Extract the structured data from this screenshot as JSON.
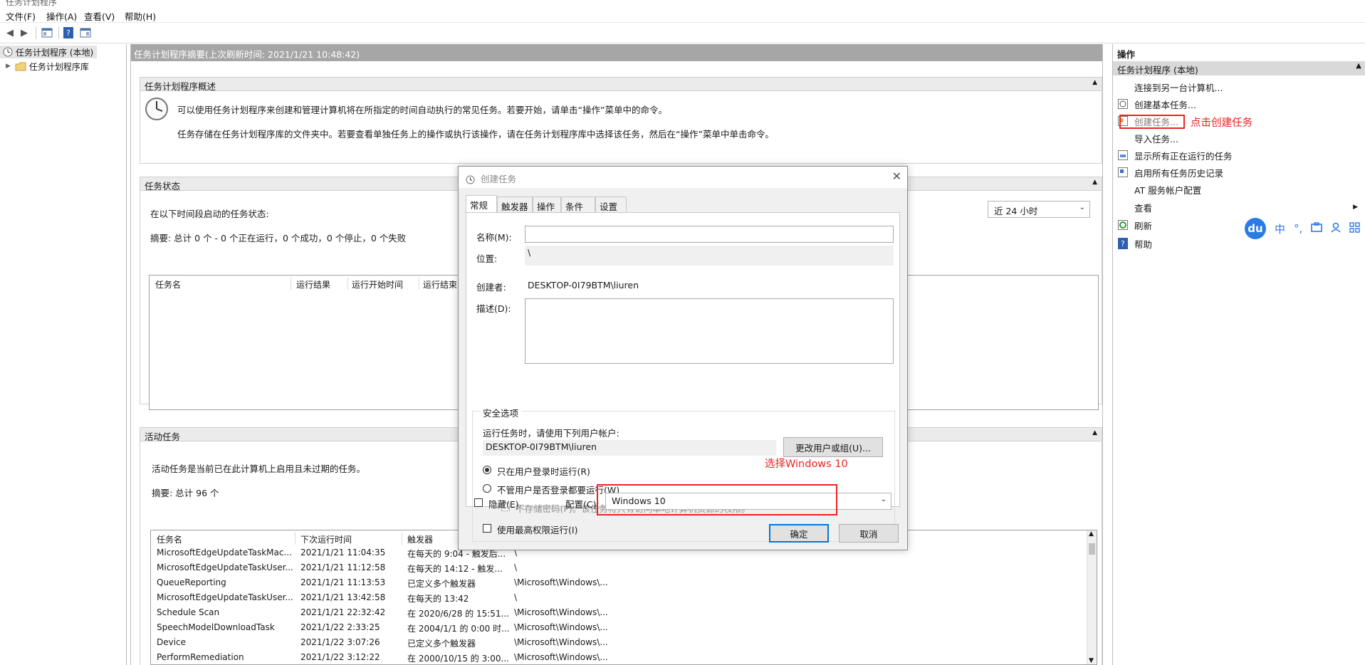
{
  "window": {
    "title": "任务计划程序"
  },
  "menu": [
    "文件(F)",
    "操作(A)",
    "查看(V)",
    "帮助(H)"
  ],
  "tree": {
    "root": "任务计划程序 (本地)",
    "library": "任务计划程序库"
  },
  "center": {
    "header": "任务计划程序摘要(上次刷新时间: 2021/1/21 10:48:42)",
    "overview": {
      "title": "任务计划程序概述",
      "line1": "可以使用任务计划程序来创建和管理计算机将在所指定的时间自动执行的常见任务。若要开始，请单击“操作”菜单中的命令。",
      "line2": "任务存储在任务计划程序库的文件夹中。若要查看单独任务上的操作或执行该操作，请在任务计划程序库中选择该任务，然后在“操作”菜单中单击命令。"
    },
    "status": {
      "title": "任务状态",
      "period_label": "在以下时间段启动的任务状态:",
      "summary": "摘要: 总计 0 个 - 0 个正在运行，0 个成功，0 个停止，0 个失败",
      "period_select": "近 24 小时",
      "columns": [
        "任务名",
        "运行结果",
        "运行开始时间",
        "运行结束时"
      ]
    },
    "active": {
      "title": "活动任务",
      "description": "活动任务是当前已在此计算机上启用且未过期的任务。",
      "summary": "摘要: 总计 96 个",
      "columns": [
        "任务名",
        "下次运行时间",
        "触发器"
      ],
      "rows": [
        [
          "MicrosoftEdgeUpdateTaskMac...",
          "2021/1/21 11:04:35",
          "在每天的 9:04 - 触发后...",
          "\\"
        ],
        [
          "MicrosoftEdgeUpdateTaskUser...",
          "2021/1/21 11:12:58",
          "在每天的 14:12 - 触发...",
          "\\"
        ],
        [
          "QueueReporting",
          "2021/1/21 11:13:53",
          "已定义多个触发器",
          "\\Microsoft\\Windows\\..."
        ],
        [
          "MicrosoftEdgeUpdateTaskUser...",
          "2021/1/21 13:42:58",
          "在每天的 13:42",
          "\\"
        ],
        [
          "Schedule Scan",
          "2021/1/21 22:32:42",
          "在 2020/6/28 的 15:51...",
          "\\Microsoft\\Windows\\..."
        ],
        [
          "SpeechModelDownloadTask",
          "2021/1/22 2:33:25",
          "在 2004/1/1 的 0:00 时...",
          "\\Microsoft\\Windows\\..."
        ],
        [
          "Device",
          "2021/1/22 3:07:26",
          "已定义多个触发器",
          "\\Microsoft\\Windows\\..."
        ],
        [
          "PerformRemediation",
          "2021/1/22 3:12:22",
          "在 2000/10/15 的 3:00...",
          "\\Microsoft\\Windows\\..."
        ]
      ]
    }
  },
  "actions": {
    "title": "操作",
    "section": "任务计划程序 (本地)",
    "items": [
      "连接到另一台计算机...",
      "创建基本任务...",
      "创建任务...",
      "导入任务...",
      "显示所有正在运行的任务",
      "启用所有任务历史记录",
      "AT 服务帐户配置",
      "查看",
      "刷新",
      "帮助"
    ]
  },
  "dialog": {
    "title": "创建任务",
    "tabs": [
      "常规",
      "触发器",
      "操作",
      "条件",
      "设置"
    ],
    "name_label": "名称(M):",
    "name_value": "",
    "location_label": "位置:",
    "location_value": "\\",
    "author_label": "创建者:",
    "author_value": "DESKTOP-0I79BTM\\liuren",
    "desc_label": "描述(D):",
    "security_title": "安全选项",
    "run_as_label": "运行任务时，请使用下列用户帐户:",
    "run_as_user": "DESKTOP-0I79BTM\\liuren",
    "change_user_button": "更改用户或组(U)...",
    "radio_logged_on": "只在用户登录时运行(R)",
    "radio_always": "不管用户是否登录都要运行(W)",
    "no_store_password": "不存储密码(P)。该任务将只有访问本地计算机资源的权限。",
    "highest_priv": "使用最高权限运行(I)",
    "hidden_label": "隐藏(E)",
    "config_label": "配置(C):",
    "config_value": "Windows 10",
    "ok": "确定",
    "cancel": "取消"
  },
  "annotations": {
    "create_task": "点击创建任务",
    "select_windows": "选择Windows 10"
  },
  "ime": {
    "logo": "du",
    "lang": "中",
    "punct": "°,"
  },
  "colors": {
    "annotation": "#ee2222",
    "selected_button": "#0078d7",
    "ime": "#2a7be4"
  }
}
